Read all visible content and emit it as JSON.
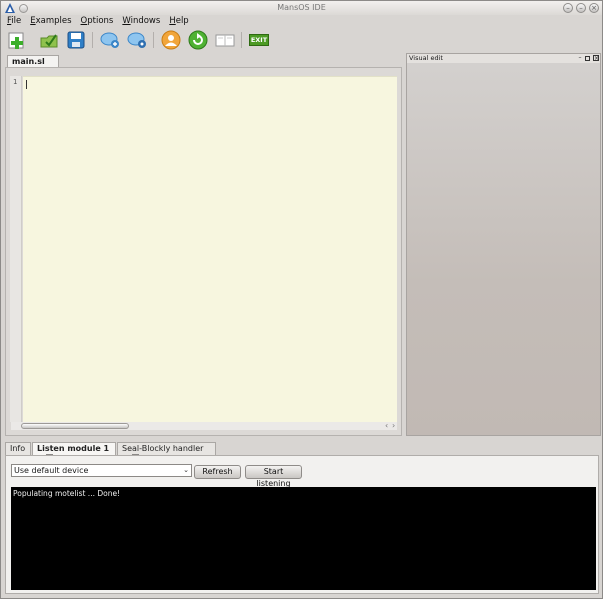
{
  "window": {
    "title": "MansOS IDE",
    "buttons": [
      "–",
      "–",
      "×"
    ]
  },
  "menu": [
    {
      "mnemonic": "F",
      "rest": "ile"
    },
    {
      "mnemonic": "E",
      "rest": "xamples"
    },
    {
      "mnemonic": "O",
      "rest": "ptions"
    },
    {
      "mnemonic": "W",
      "rest": "indows"
    },
    {
      "mnemonic": "H",
      "rest": "elp"
    }
  ],
  "toolbar": {
    "exit_label": "EXIT",
    "icons": [
      "new-file-icon",
      "open-file-icon",
      "save-icon",
      "chat-add-icon",
      "chat-settings-icon",
      "user-icon",
      "refresh-icon",
      "book-icon",
      "exit-icon"
    ],
    "colors": {
      "green": "#3cae2b",
      "blue": "#2f7fc7",
      "orange": "#f1a53a",
      "exit_bg": "#4c9a24"
    }
  },
  "editor": {
    "tab_label": "main.sl",
    "line_numbers": [
      "1"
    ],
    "background": "#f7f6df"
  },
  "visual_panel": {
    "title": "Visual edit"
  },
  "bottom_tabs": [
    "Info",
    "Listen module 1",
    "Seal-Blockly handler"
  ],
  "listen": {
    "device_value": "Use default device",
    "refresh_label": "Refresh",
    "start_label": "Start listening",
    "console_text": "Populating motelist ... Done!"
  }
}
